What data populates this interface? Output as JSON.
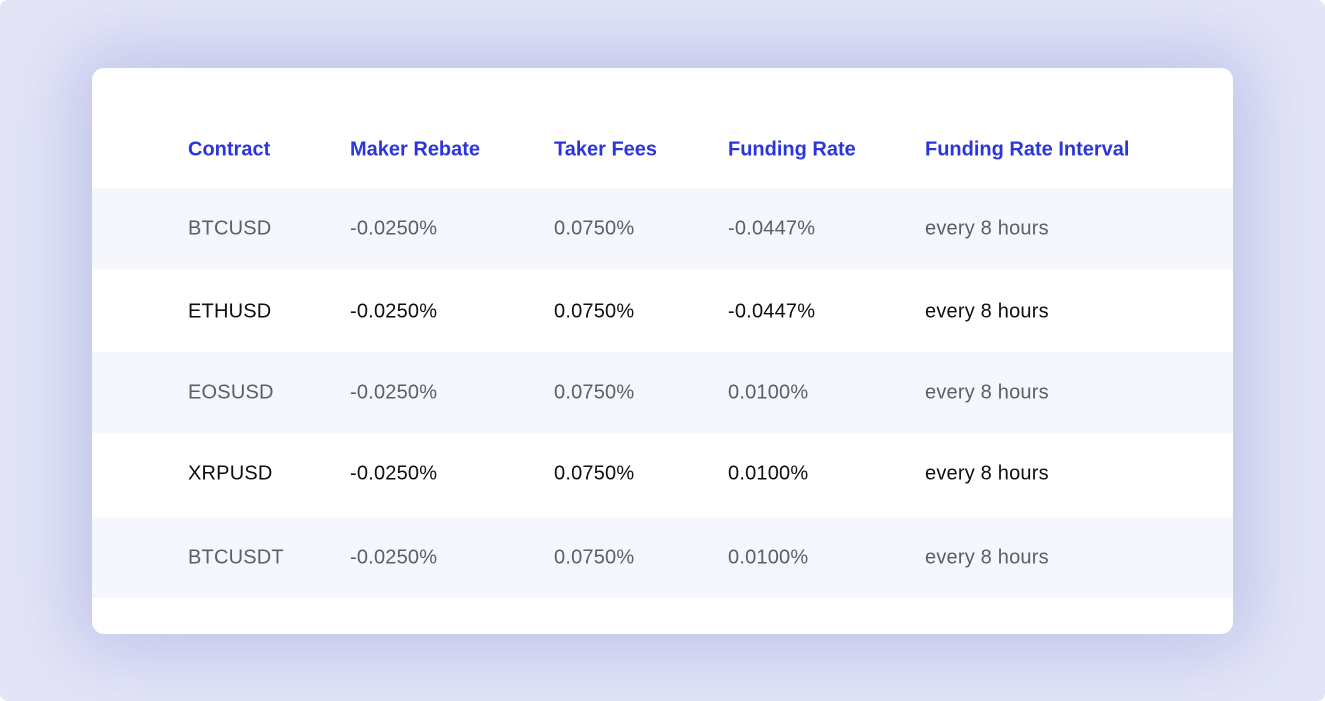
{
  "table": {
    "headers": [
      "Contract",
      "Maker Rebate",
      "Taker Fees",
      "Funding Rate",
      "Funding Rate Interval"
    ],
    "rows": [
      [
        "BTCUSD",
        "-0.0250%",
        "0.0750%",
        "-0.0447%",
        "every 8 hours"
      ],
      [
        "ETHUSD",
        "-0.0250%",
        "0.0750%",
        "-0.0447%",
        "every 8 hours"
      ],
      [
        "EOSUSD",
        "-0.0250%",
        "0.0750%",
        "0.0100%",
        "every 8 hours"
      ],
      [
        "XRPUSD",
        "-0.0250%",
        "0.0750%",
        "0.0100%",
        "every 8 hours"
      ],
      [
        "BTCUSDT",
        "-0.0250%",
        "0.0750%",
        "0.0100%",
        "every 8 hours"
      ]
    ]
  },
  "colors": {
    "header_text": "#2b36d9",
    "muted_text": "#5a5d6b",
    "dark_text": "#0d0e12",
    "stripe_bg": "#f6f7fd",
    "backdrop_bg": "#e3e5f7"
  }
}
